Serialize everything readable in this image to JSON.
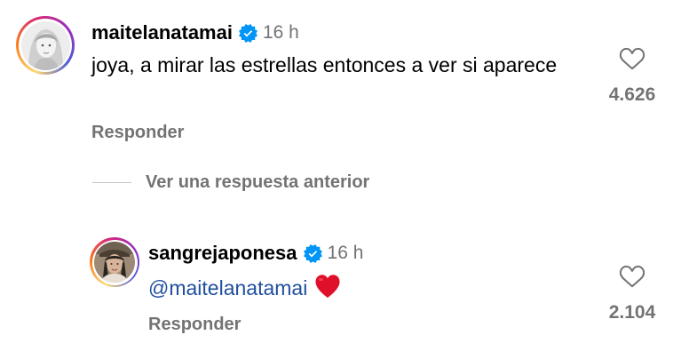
{
  "comments": [
    {
      "username": "maitelanatamai",
      "time": "16 h",
      "text": "joya, a mirar las estrellas entonces a ver si aparece",
      "reply_label": "Responder",
      "like_count": "4.626"
    },
    {
      "username": "sangrejaponesa",
      "time": "16 h",
      "mention": "@maitelanatamai",
      "reply_label": "Responder",
      "like_count": "2.104"
    }
  ],
  "view_replies_label": "Ver una respuesta anterior",
  "colors": {
    "verified": "#0095f6",
    "muted": "#737373",
    "mention": "#1f4f9e",
    "heart_emoji": "#e0102a"
  }
}
